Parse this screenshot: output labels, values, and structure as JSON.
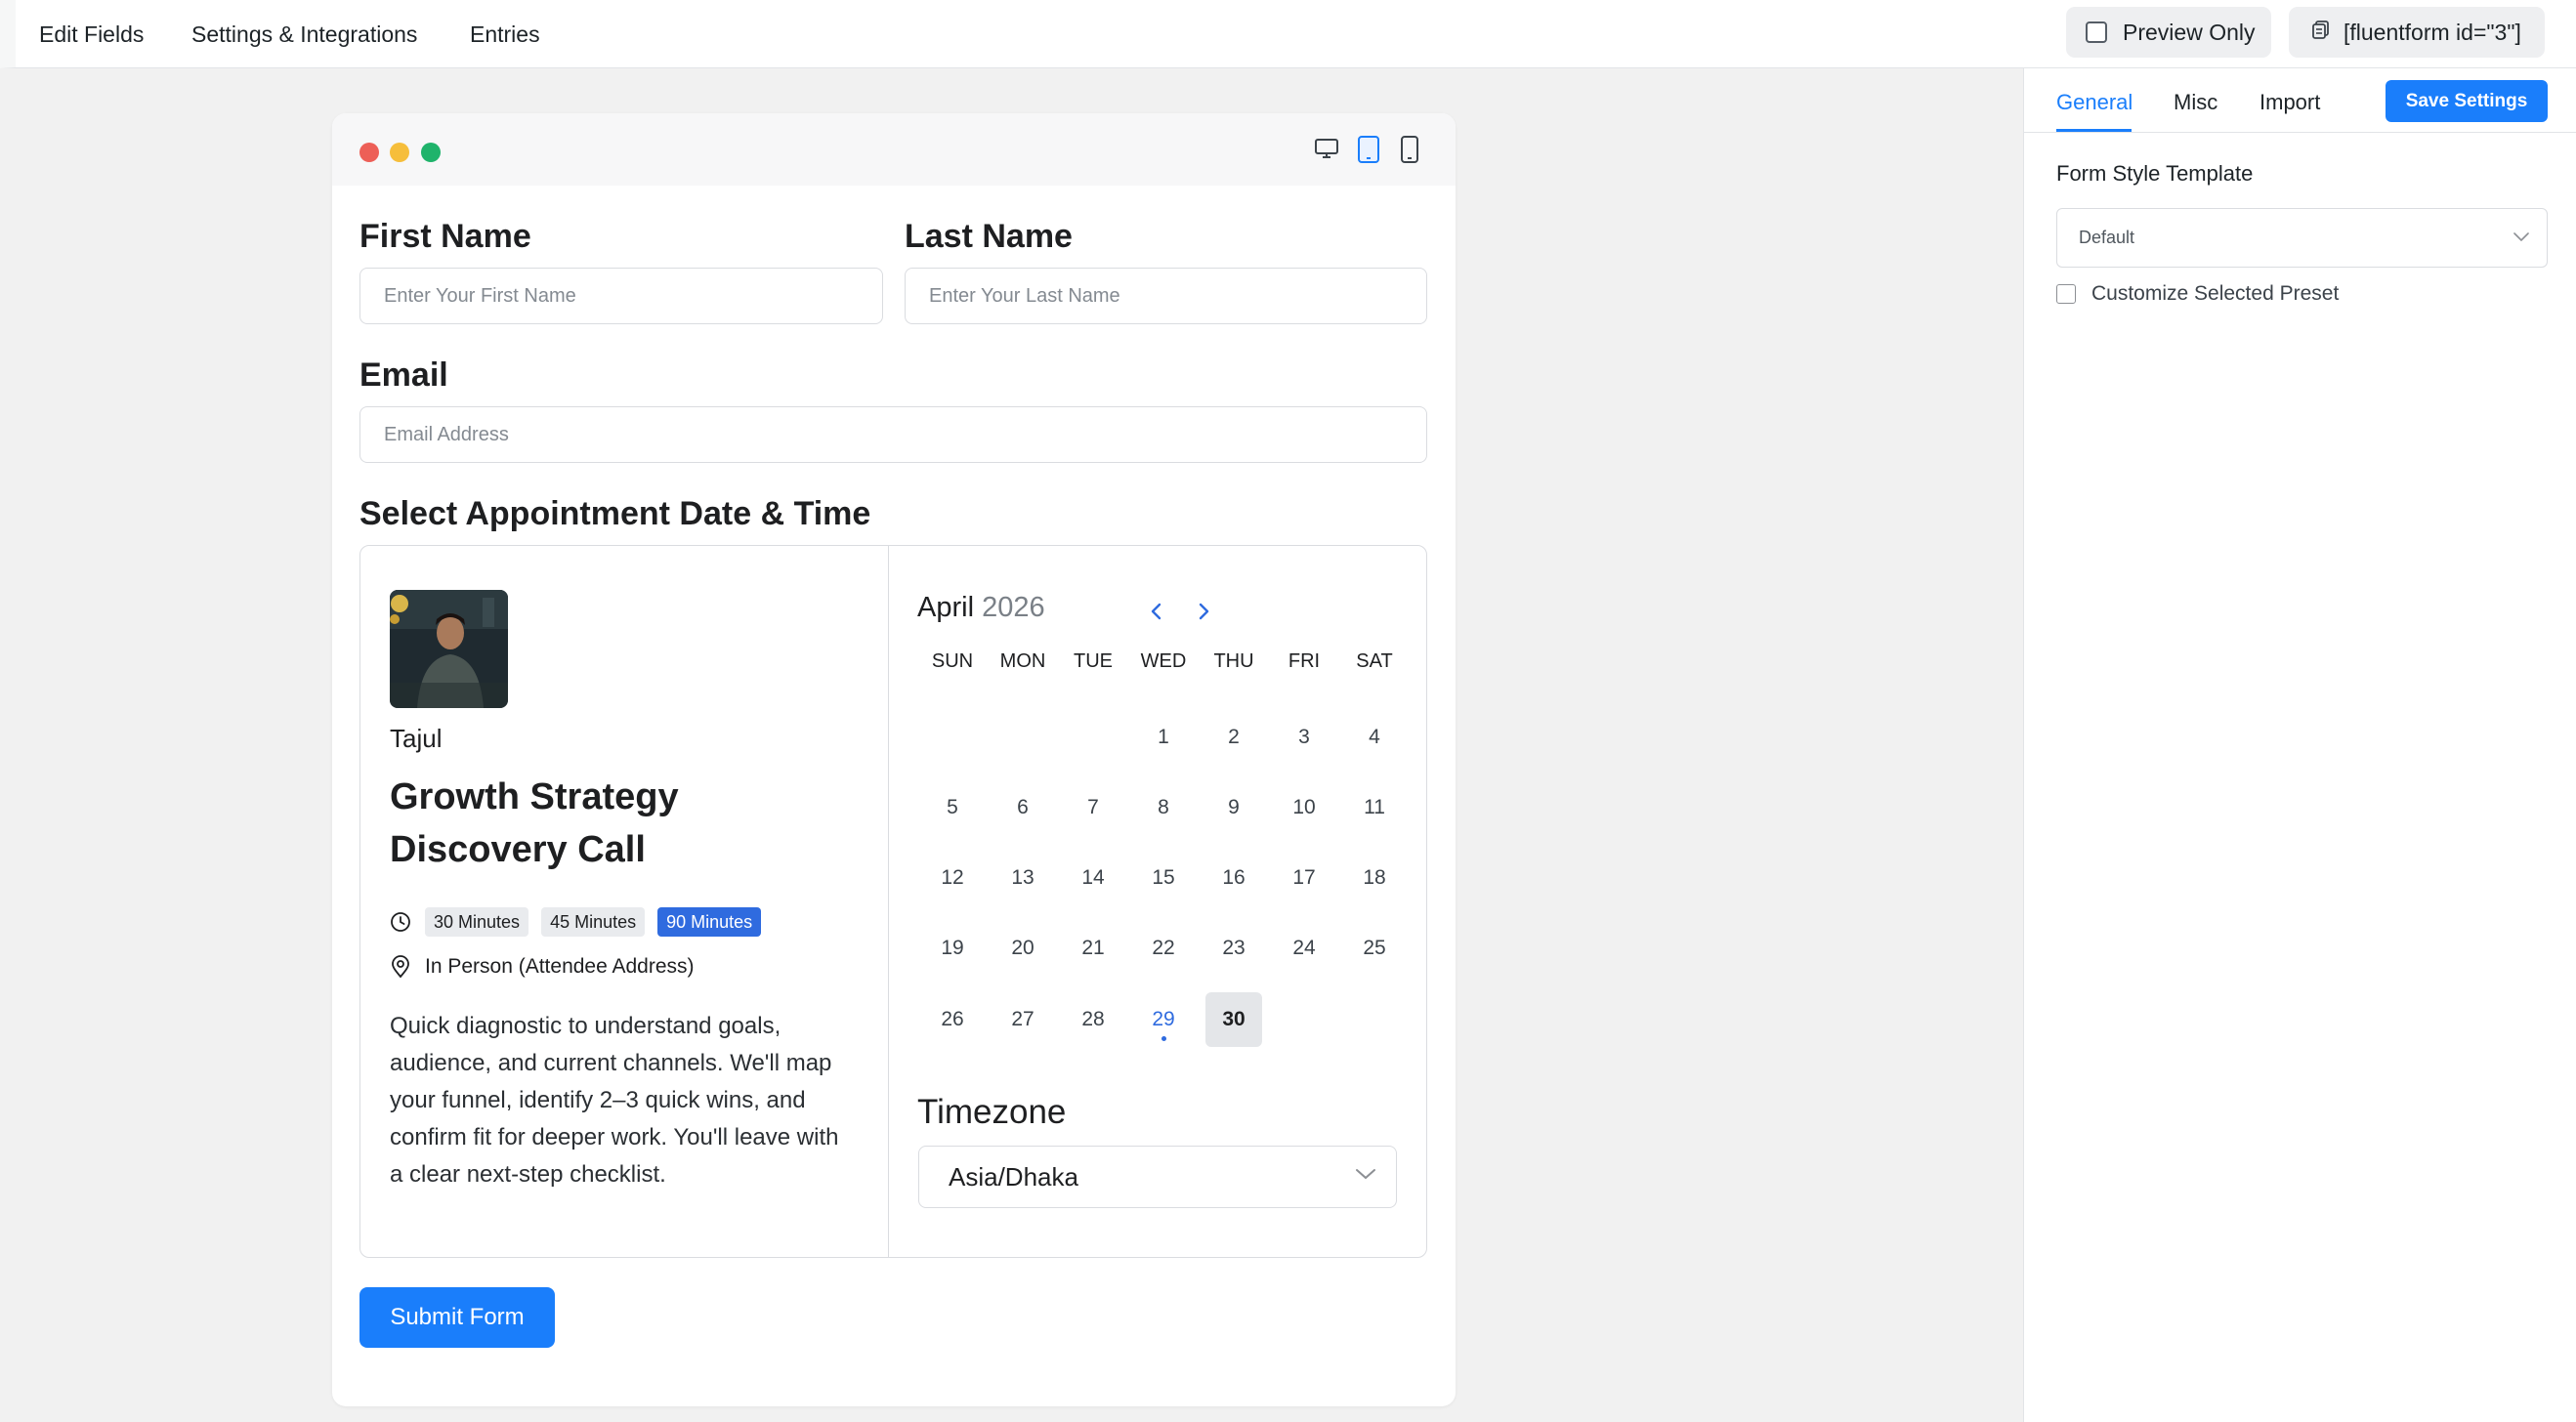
{
  "topbar": {
    "nav": [
      "Edit Fields",
      "Settings & Integrations",
      "Entries"
    ],
    "preview_label": "Preview Only",
    "shortcode": "[fluentform id=\"3\"]"
  },
  "form": {
    "first_name_label": "First Name",
    "first_name_placeholder": "Enter Your First Name",
    "last_name_label": "Last Name",
    "last_name_placeholder": "Enter Your Last Name",
    "email_label": "Email",
    "email_placeholder": "Email Address",
    "appointment_label": "Select Appointment Date & Time",
    "submit_label": "Submit Form"
  },
  "booking": {
    "host_name": "Tajul",
    "event_title": "Growth Strategy Discovery Call",
    "durations": [
      "30 Minutes",
      "45 Minutes",
      "90 Minutes"
    ],
    "active_duration": "90 Minutes",
    "location": "In Person (Attendee Address)",
    "description": "Quick diagnostic to understand goals, audience, and current channels. We'll map your funnel, identify 2–3 quick wins, and confirm fit for deeper work. You'll leave with a clear next-step checklist."
  },
  "calendar": {
    "month": "April",
    "year": "2026",
    "weekdays": [
      "SUN",
      "MON",
      "TUE",
      "WED",
      "THU",
      "FRI",
      "SAT"
    ],
    "weeks": [
      [
        "",
        "",
        "",
        "1",
        "2",
        "3",
        "4"
      ],
      [
        "5",
        "6",
        "7",
        "8",
        "9",
        "10",
        "11"
      ],
      [
        "12",
        "13",
        "14",
        "15",
        "16",
        "17",
        "18"
      ],
      [
        "19",
        "20",
        "21",
        "22",
        "23",
        "24",
        "25"
      ],
      [
        "26",
        "27",
        "28",
        "29",
        "30",
        "",
        ""
      ]
    ],
    "today": "29",
    "selected": "30"
  },
  "timezone": {
    "label": "Timezone",
    "value": "Asia/Dhaka"
  },
  "panel": {
    "tabs": [
      "General",
      "Misc",
      "Import"
    ],
    "active_tab": "General",
    "save_label": "Save Settings",
    "style_label": "Form Style Template",
    "style_value": "Default",
    "customize_label": "Customize Selected Preset"
  },
  "colors": {
    "accent": "#1a7efb",
    "chip_active": "#2f6bdf",
    "dot_red": "#ed5f57",
    "dot_yellow": "#f6be3b",
    "dot_green": "#1fb36b"
  }
}
